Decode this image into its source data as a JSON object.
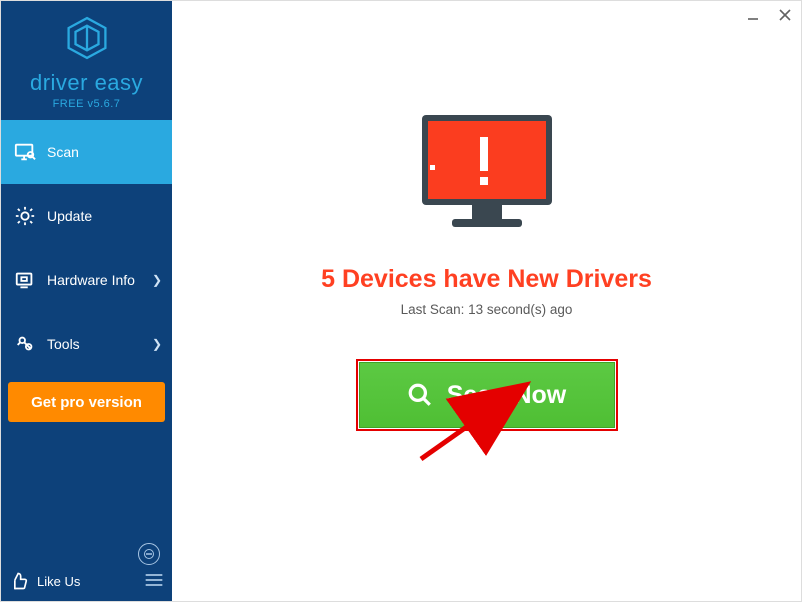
{
  "brand": {
    "name": "driver easy",
    "version": "FREE v5.6.7"
  },
  "sidebar": {
    "items": [
      {
        "label": "Scan"
      },
      {
        "label": "Update"
      },
      {
        "label": "Hardware Info"
      },
      {
        "label": "Tools"
      }
    ],
    "pro_label": "Get pro version",
    "like_label": "Like Us"
  },
  "main": {
    "headline": "5 Devices have New Drivers",
    "subline": "Last Scan: 13 second(s) ago",
    "scan_button": "Scan Now"
  },
  "colors": {
    "accent": "#2aa9e0",
    "sidebar": "#0d417a",
    "pro": "#ff8a00",
    "green": "#4fbf34",
    "alert_red": "#ff4022"
  }
}
